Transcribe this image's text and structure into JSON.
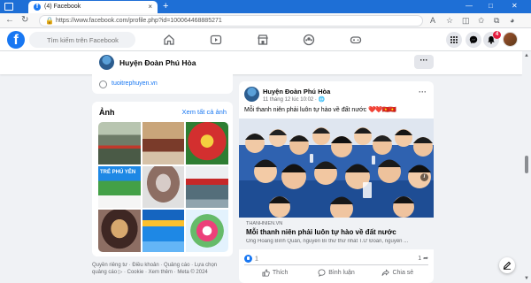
{
  "browser": {
    "tab_title": "(4) Facebook",
    "tab_close": "×",
    "new_tab": "+",
    "url": "https://www.facebook.com/profile.php?id=100064468885271",
    "window_controls": [
      "—",
      "□",
      "✕"
    ]
  },
  "fb": {
    "logo": "f",
    "search_placeholder": "Tìm kiếm trên Facebook",
    "notification_count": "4"
  },
  "page": {
    "name": "Huyện Đoàn Phú Hòa",
    "more": "···"
  },
  "intro": {
    "link": "tuoitrephuyen.vn"
  },
  "photos": {
    "title": "Ảnh",
    "see_all": "Xem tất cả ảnh",
    "captions": [
      "",
      "",
      "",
      "TRẺ PHÚ YÊN",
      "",
      "",
      "",
      "",
      ""
    ]
  },
  "footer": {
    "text": "Quyền riêng tư · Điều khoản · Quảng cáo · Lựa chọn quảng cáo ▷ · Cookie · Xem thêm · Meta © 2024"
  },
  "post": {
    "author": "Huyện Đoàn Phú Hòa",
    "time": "11 tháng 12 lúc 10:02 · 🌐",
    "more": "···",
    "text": "Mỗi thanh niên phải luôn tự hào về đất nước",
    "emojis": "❤️❤️🇻🇳🇻🇳",
    "link_domain": "THANHNIEN.VN",
    "link_title": "Mỗi thanh niên phải luôn tự hào về đất nước",
    "link_desc": "Ông Hoàng Bình Quân, nguyên Bí thư thứ nhất T.Ư Đoàn, nguyên ...",
    "info": "i",
    "reaction_count": "1",
    "share_count": "1",
    "actions": {
      "like": "Thích",
      "comment": "Bình luận",
      "share": "Chia sẻ"
    }
  },
  "colors": {
    "fb_blue": "#1877f2",
    "browser_blue": "#1e6fd6",
    "bg": "#f0f2f5"
  },
  "icons": [
    "windows-icon",
    "facebook-favicon",
    "back-icon",
    "refresh-icon",
    "lock-icon",
    "star-icon",
    "extensions-icon",
    "home-icon",
    "video-icon",
    "marketplace-icon",
    "groups-icon",
    "gaming-icon",
    "menu-grid-icon",
    "messenger-icon",
    "bell-icon",
    "link-icon",
    "like-icon",
    "comment-icon",
    "share-icon",
    "compose-icon",
    "info-icon"
  ]
}
